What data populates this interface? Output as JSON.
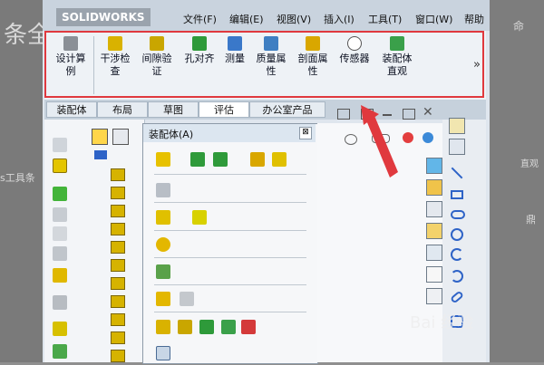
{
  "background": {
    "left_text_top": "条全",
    "left_text_mid": "s工具条",
    "right_text_top": "命",
    "right_text_mid": "直观",
    "right_text_low": "鼎"
  },
  "app": {
    "logo": "SOLIDWORKS"
  },
  "menu": [
    "文件(F)",
    "编辑(E)",
    "视图(V)",
    "插入(I)",
    "工具(T)",
    "窗口(W)",
    "帮助"
  ],
  "toolbar": {
    "buttons": [
      {
        "label": "设计算\n例",
        "icon": "design-study-icon"
      },
      {
        "label": "干涉检\n查",
        "icon": "interference-check-icon"
      },
      {
        "label": "间隙验\n证",
        "icon": "clearance-verify-icon"
      },
      {
        "label": "孔对齐",
        "icon": "hole-align-icon"
      },
      {
        "label": "测量",
        "icon": "measure-icon"
      },
      {
        "label": "质量属\n性",
        "icon": "mass-properties-icon"
      },
      {
        "label": "剖面属\n性",
        "icon": "section-properties-icon"
      },
      {
        "label": "传感器",
        "icon": "sensor-icon"
      },
      {
        "label": "装配体\n直观",
        "icon": "assembly-visualization-icon"
      }
    ],
    "overflow": "»"
  },
  "tabs": [
    {
      "label": "装配体",
      "active": false
    },
    {
      "label": "布局",
      "active": false
    },
    {
      "label": "草图",
      "active": false
    },
    {
      "label": "评估",
      "active": true
    },
    {
      "label": "办公室产品",
      "active": false
    }
  ],
  "dropdown": {
    "title": "装配体(A)",
    "close": "⊠"
  },
  "colors": {
    "highlight": "#e0393e",
    "accent": "#2e63c7"
  },
  "watermark": "Bai 经验"
}
